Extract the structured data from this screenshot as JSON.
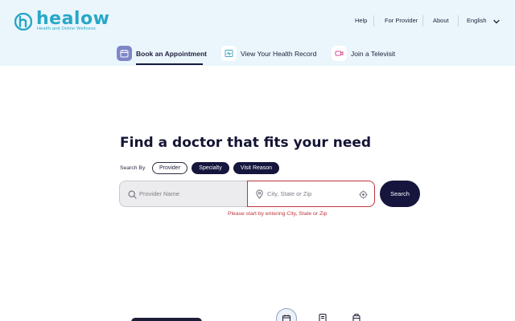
{
  "brand": {
    "name": "healow",
    "tagline": "Health and Online Wellness",
    "color": "#28a7c7"
  },
  "topnav": {
    "items": [
      "Help",
      "For Provider",
      "About"
    ],
    "language": "English"
  },
  "tabs": [
    {
      "label": "Book an Appointment",
      "icon": "calendar-icon",
      "active": true
    },
    {
      "label": "View Your Health Record",
      "icon": "health-record-icon",
      "active": false
    },
    {
      "label": "Join a Televisit",
      "icon": "video-camera-icon",
      "active": false
    }
  ],
  "main": {
    "headline": "Find a doctor that fits your need",
    "search_by_label": "Search By",
    "filters": [
      {
        "label": "Provider",
        "style": "outline"
      },
      {
        "label": "Specialty",
        "style": "solid"
      },
      {
        "label": "Visit Reason",
        "style": "solid"
      }
    ],
    "provider_field": {
      "placeholder": "Provider Name",
      "value": ""
    },
    "location_field": {
      "placeholder": "City, State or Zip",
      "value": ""
    },
    "search_button": "Search",
    "error": "Please start by entering City, State or Zip"
  },
  "colors": {
    "header_bg": "#eaf6fc",
    "primary_dark": "#15153d",
    "error": "#c0343d"
  }
}
